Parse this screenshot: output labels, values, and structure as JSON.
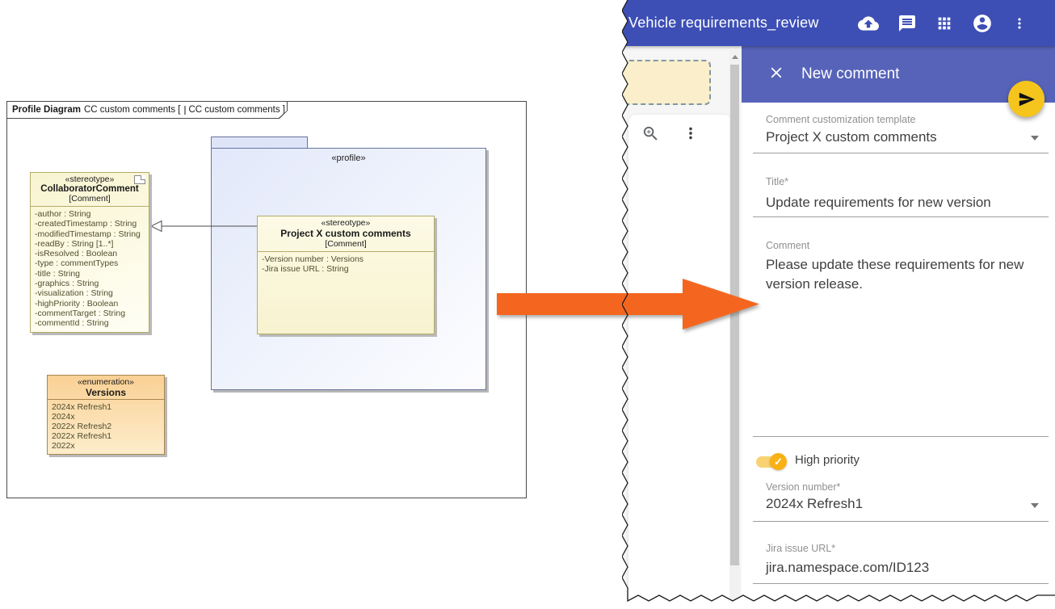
{
  "diagram": {
    "title_bold": "Profile Diagram",
    "title_text": "CC custom comments [",
    "title_ref": "CC custom comments ]",
    "profile_stereotype": "«profile»",
    "collaborator": {
      "stereotype": "«stereotype»",
      "name": "CollaboratorComment",
      "metaclass": "[Comment]",
      "attributes": [
        "-author : String",
        "-createdTimestamp : String",
        "-modifiedTimestamp : String",
        "-readBy : String [1..*]",
        "-isResolved : Boolean",
        "-type : commentTypes",
        "-title : String",
        "-graphics : String",
        "-visualization : String",
        "-highPriority : Boolean",
        "-commentTarget : String",
        "-commentId : String"
      ]
    },
    "projectx": {
      "stereotype": "«stereotype»",
      "name": "Project X custom comments",
      "metaclass": "[Comment]",
      "attributes": [
        "-Version number : Versions",
        "-Jira issue URL : String"
      ]
    },
    "versions": {
      "stereotype": "«enumeration»",
      "name": "Versions",
      "literals": [
        "2024x Refresh1",
        "2024x",
        "2022x Refresh2",
        "2022x Refresh1",
        "2022x"
      ]
    }
  },
  "app": {
    "title": "Vehicle requirements_review",
    "header_icons": [
      "cloud-upload-icon",
      "comments-icon",
      "app-grid-icon",
      "account-icon",
      "more-menu-icon"
    ],
    "panel": {
      "title": "New comment",
      "template_field": {
        "label": "Comment customization template",
        "value": "Project X custom comments"
      },
      "title_field": {
        "label": "Title*",
        "value": "Update requirements for new version"
      },
      "comment_field": {
        "label": "Comment",
        "value": "Please update these requirements for new version release."
      },
      "high_priority": {
        "label": "High priority",
        "enabled": true,
        "check_glyph": "✓"
      },
      "version_field": {
        "label": "Version number*",
        "value": "2024x Refresh1"
      },
      "jira_field": {
        "label": "Jira issue URL*",
        "value": "jira.namespace.com/ID123"
      }
    }
  },
  "colors": {
    "appbar_blue": "#3D4FB5",
    "subheader_blue": "#5663B8",
    "fab_yellow": "#F5C51D",
    "toggle_amber": "#F9B115",
    "arrow_orange": "#F4661F"
  }
}
